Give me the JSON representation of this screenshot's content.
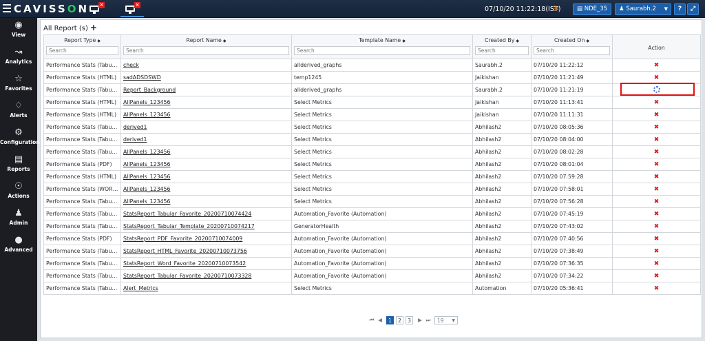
{
  "header": {
    "brand_left": "CAVISS",
    "brand_o": "O",
    "brand_right": "N",
    "close_x": "×",
    "datetime": "07/10/20 11:22:18(IST)",
    "nde": "NDE_35",
    "user": "Saurabh.2",
    "help": "?",
    "accent_color": "#1c5fa8"
  },
  "sidebar": {
    "items": [
      {
        "label": "View",
        "icon": "eye-icon"
      },
      {
        "label": "Analytics",
        "icon": "chart-line-icon"
      },
      {
        "label": "Favorites",
        "icon": "star-icon"
      },
      {
        "label": "Alerts",
        "icon": "bell-icon"
      },
      {
        "label": "Configuration",
        "icon": "gears-icon"
      },
      {
        "label": "Reports",
        "icon": "document-icon"
      },
      {
        "label": "Actions",
        "icon": "person-circle-icon"
      },
      {
        "label": "Admin",
        "icon": "user-icon"
      },
      {
        "label": "Advanced",
        "icon": "dot-circle-icon"
      }
    ]
  },
  "panel": {
    "title": "All Report (s)",
    "add": "+"
  },
  "table": {
    "columns": [
      "Report Type",
      "Report Name",
      "Template Name",
      "Created By",
      "Created On",
      "Action"
    ],
    "search_placeholder": "Search",
    "rows": [
      {
        "type": "Performance Stats (Tabular)",
        "name": "check",
        "template": "allderived_graphs",
        "by": "Saurabh.2",
        "on": "07/10/20 11:22:12",
        "action": "delete"
      },
      {
        "type": "Performance Stats (HTML)",
        "name": "sadADSDSWD",
        "template": "temp1245",
        "by": "Jaikishan",
        "on": "07/10/20 11:21:49",
        "action": "delete"
      },
      {
        "type": "Performance Stats (Tabular)",
        "name": "Report_Background",
        "template": "allderived_graphs",
        "by": "Saurabh.2",
        "on": "07/10/20 11:21:19",
        "action": "loading"
      },
      {
        "type": "Performance Stats (HTML)",
        "name": "AllPanels_123456",
        "template": "Select Metrics",
        "by": "Jaikishan",
        "on": "07/10/20 11:13:41",
        "action": "delete"
      },
      {
        "type": "Performance Stats (HTML)",
        "name": "AllPanels_123456",
        "template": "Select Metrics",
        "by": "Jaikishan",
        "on": "07/10/20 11:11:31",
        "action": "delete"
      },
      {
        "type": "Performance Stats (Tabular)",
        "name": "derived1",
        "template": "Select Metrics",
        "by": "Abhilash2",
        "on": "07/10/20 08:05:36",
        "action": "delete"
      },
      {
        "type": "Performance Stats (Tabular)",
        "name": "derived1",
        "template": "Select Metrics",
        "by": "Abhilash2",
        "on": "07/10/20 08:04:00",
        "action": "delete"
      },
      {
        "type": "Performance Stats (Tabular)",
        "name": "AllPanels_123456",
        "template": "Select Metrics",
        "by": "Abhilash2",
        "on": "07/10/20 08:02:28",
        "action": "delete"
      },
      {
        "type": "Performance Stats (PDF)",
        "name": "AllPanels_123456",
        "template": "Select Metrics",
        "by": "Abhilash2",
        "on": "07/10/20 08:01:04",
        "action": "delete"
      },
      {
        "type": "Performance Stats (HTML)",
        "name": "AllPanels_123456",
        "template": "Select Metrics",
        "by": "Abhilash2",
        "on": "07/10/20 07:59:28",
        "action": "delete"
      },
      {
        "type": "Performance Stats (WORD)",
        "name": "AllPanels_123456",
        "template": "Select Metrics",
        "by": "Abhilash2",
        "on": "07/10/20 07:58:01",
        "action": "delete"
      },
      {
        "type": "Performance Stats (Tabular)",
        "name": "AllPanels_123456",
        "template": "Select Metrics",
        "by": "Abhilash2",
        "on": "07/10/20 07:56:28",
        "action": "delete"
      },
      {
        "type": "Performance Stats (Tabular)",
        "name": "StatsReport_Tabular_Favorite_20200710074424",
        "template": "Automation_Favorite (Automation)",
        "by": "Abhilash2",
        "on": "07/10/20 07:45:19",
        "action": "delete"
      },
      {
        "type": "Performance Stats (Tabular)",
        "name": "StatsReport_Tabular_Template_20200710074217",
        "template": "GeneratorHealth",
        "by": "Abhilash2",
        "on": "07/10/20 07:43:02",
        "action": "delete"
      },
      {
        "type": "Performance Stats (PDF)",
        "name": "StatsReport_PDF_Favorite_20200710074009",
        "template": "Automation_Favorite (Automation)",
        "by": "Abhilash2",
        "on": "07/10/20 07:40:56",
        "action": "delete"
      },
      {
        "type": "Performance Stats (Tabular)",
        "name": "StatsReport_HTML_Favorite_20200710073756",
        "template": "Automation_Favorite (Automation)",
        "by": "Abhilash2",
        "on": "07/10/20 07:38:49",
        "action": "delete"
      },
      {
        "type": "Performance Stats (Tabular)",
        "name": "StatsReport_Word_Favorite_20200710073542",
        "template": "Automation_Favorite (Automation)",
        "by": "Abhilash2",
        "on": "07/10/20 07:36:35",
        "action": "delete"
      },
      {
        "type": "Performance Stats (Tabular)",
        "name": "StatsReport_Tabular_Favorite_20200710073328",
        "template": "Automation_Favorite (Automation)",
        "by": "Abhilash2",
        "on": "07/10/20 07:34:22",
        "action": "delete"
      },
      {
        "type": "Performance Stats (Tabular)",
        "name": "Alert_Metrics",
        "template": "Select Metrics",
        "by": "Automation",
        "on": "07/10/20 05:36:41",
        "action": "delete"
      }
    ]
  },
  "pager": {
    "pages": [
      "1",
      "2",
      "3"
    ],
    "current": "1",
    "rows_per_page": "19"
  }
}
